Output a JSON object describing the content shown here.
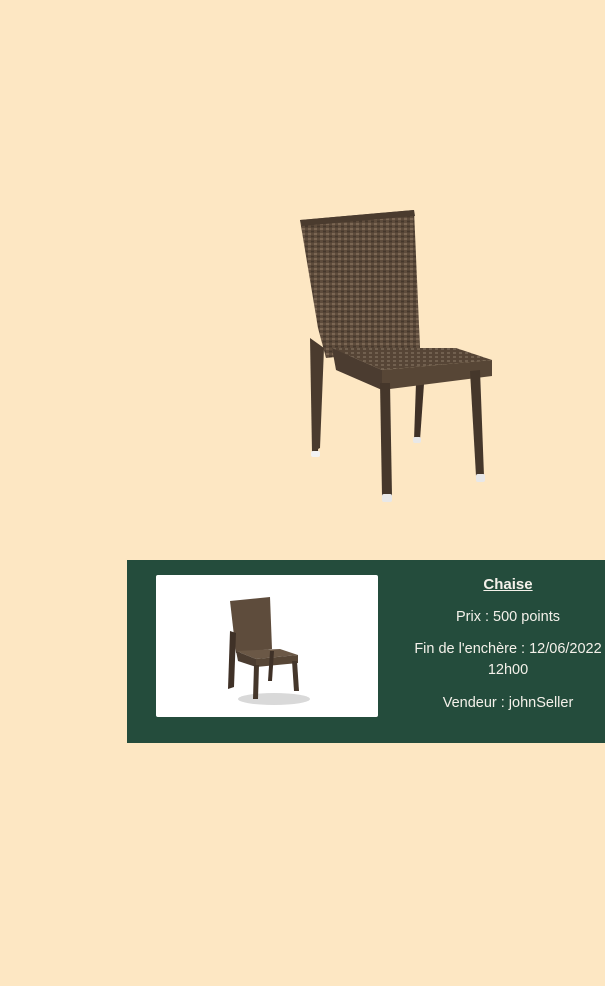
{
  "hero": {
    "icon": "wicker-chair-image"
  },
  "listing": {
    "title": "Chaise",
    "price": "Prix : 500 points",
    "end_label": "Fin de l'enchère : 12/06/2022",
    "end_time": "12h00",
    "seller": "Vendeur : johnSeller",
    "thumbnail_icon": "chair-thumbnail-image"
  },
  "colors": {
    "page_background": "#fde7c3",
    "card_background": "#244c3c",
    "card_text": "#f4f1ea",
    "chair_brown": "#5b4a3b"
  }
}
